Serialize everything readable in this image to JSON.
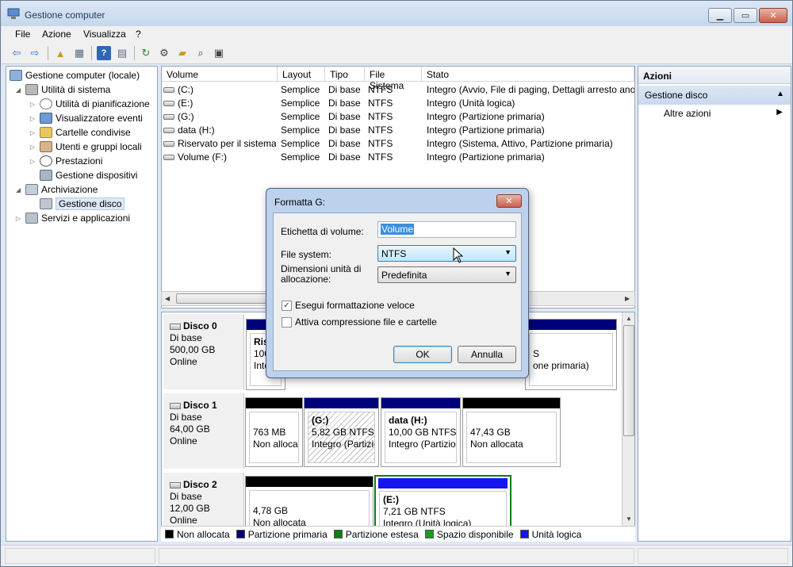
{
  "window": {
    "title": "Gestione computer"
  },
  "menu": [
    "File",
    "Azione",
    "Visualizza",
    "?"
  ],
  "tree": {
    "root": "Gestione computer (locale)",
    "system_tools": "Utilità di sistema",
    "items": [
      "Utilità di pianificazione",
      "Visualizzatore eventi",
      "Cartelle condivise",
      "Utenti e gruppi locali",
      "Prestazioni",
      "Gestione dispositivi"
    ],
    "storage": "Archiviazione",
    "disk_mgmt": "Gestione disco",
    "services": "Servizi e applicazioni"
  },
  "volume_list": {
    "headers": [
      "Volume",
      "Layout",
      "Tipo",
      "File Sistema",
      "Stato"
    ],
    "rows": [
      [
        "(C:)",
        "Semplice",
        "Di base",
        "NTFS",
        "Integro (Avvio, File di paging, Dettagli arresto ano"
      ],
      [
        "(E:)",
        "Semplice",
        "Di base",
        "NTFS",
        "Integro (Unità logica)"
      ],
      [
        "(G:)",
        "Semplice",
        "Di base",
        "NTFS",
        "Integro (Partizione primaria)"
      ],
      [
        "data (H:)",
        "Semplice",
        "Di base",
        "NTFS",
        "Integro (Partizione primaria)"
      ],
      [
        "Riservato per il sistema",
        "Semplice",
        "Di base",
        "NTFS",
        "Integro (Sistema, Attivo, Partizione primaria)"
      ],
      [
        "Volume (F:)",
        "Semplice",
        "Di base",
        "NTFS",
        "Integro (Partizione primaria)"
      ]
    ]
  },
  "disks": {
    "disk0": {
      "name": "Disco 0",
      "type": "Di base",
      "size": "500,00 GB",
      "status": "Online",
      "p1_l1": "Ris",
      "p1_l2": "100",
      "p1_l3": "Inte",
      "p2_l2": "S",
      "p2_l3": "one primaria)"
    },
    "disk1": {
      "name": "Disco 1",
      "type": "Di base",
      "size": "64,00 GB",
      "status": "Online",
      "parts": [
        {
          "title": "",
          "line1": "763 MB",
          "line2": "Non allocata"
        },
        {
          "title": "(G:)",
          "line1": "5,82 GB NTFS",
          "line2": "Integro (Partizio"
        },
        {
          "title": "data  (H:)",
          "line1": "10,00 GB NTFS",
          "line2": "Integro (Partizior"
        },
        {
          "title": "",
          "line1": "47,43 GB",
          "line2": "Non allocata"
        }
      ]
    },
    "disk2": {
      "name": "Disco 2",
      "type": "Di base",
      "size": "12,00 GB",
      "status": "Online",
      "parts": [
        {
          "title": "",
          "line1": "4,78 GB",
          "line2": "Non allocata"
        },
        {
          "title": "(E:)",
          "line1": "7,21 GB NTFS",
          "line2": "Integro (Unità logica)"
        }
      ]
    }
  },
  "legend": [
    {
      "label": "Non allocata",
      "color": "#000000"
    },
    {
      "label": "Partizione primaria",
      "color": "#00007b"
    },
    {
      "label": "Partizione estesa",
      "color": "#0f7d16"
    },
    {
      "label": "Spazio disponibile",
      "color": "#1c9c1c"
    },
    {
      "label": "Unità logica",
      "color": "#1515f0"
    }
  ],
  "actions": {
    "header": "Azioni",
    "section": "Gestione disco",
    "more": "Altre azioni"
  },
  "dialog": {
    "title": "Formatta G:",
    "volume_label_caption": "Etichetta di volume:",
    "volume_label_value": "Volume",
    "fs_caption": "File system:",
    "fs_value": "NTFS",
    "alloc_caption_1": "Dimensioni unità di",
    "alloc_caption_2": "allocazione:",
    "alloc_value": "Predefinita",
    "quick_format": "Esegui formattazione veloce",
    "quick_format_checked": true,
    "compression": "Attiva compressione file e cartelle",
    "compression_checked": false,
    "ok": "OK",
    "cancel": "Annulla"
  },
  "colors": {
    "primary": "#00007b",
    "unallocated": "#000000",
    "logical": "#1515f0",
    "extended": "#0f7d16"
  }
}
